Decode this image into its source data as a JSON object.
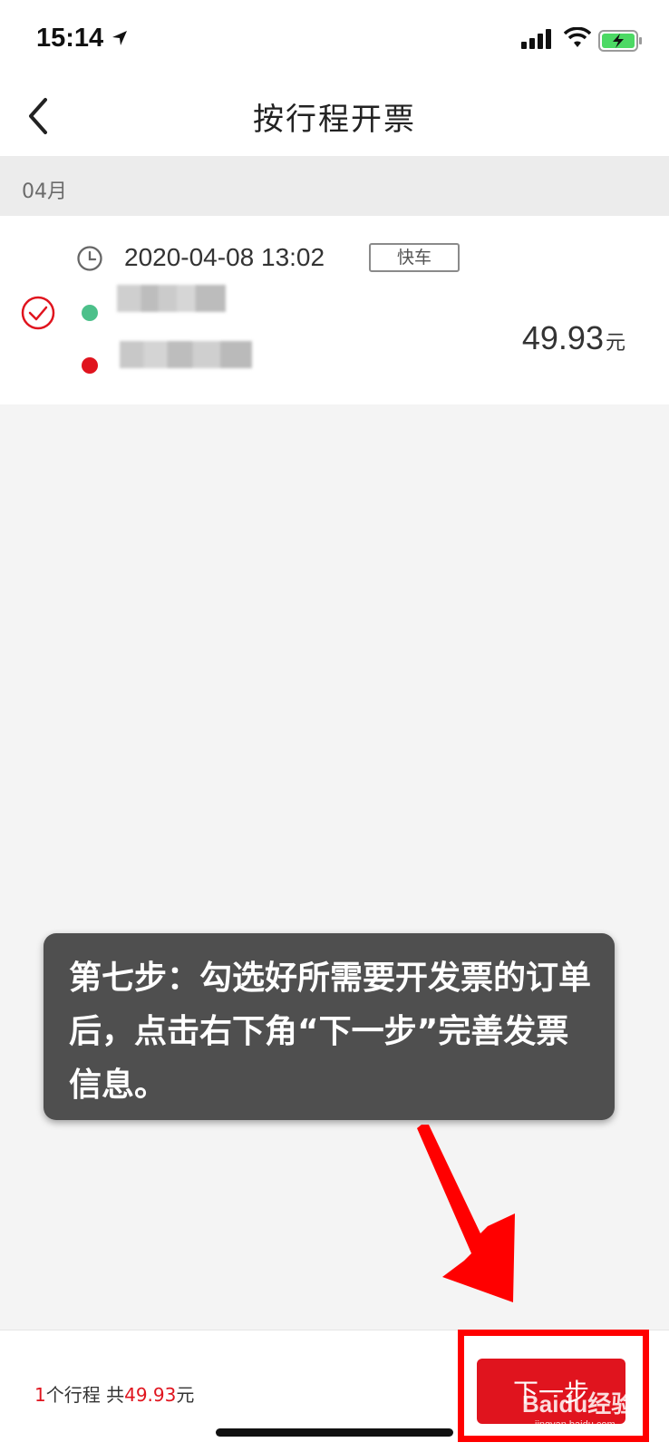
{
  "status_bar": {
    "time": "15:14"
  },
  "nav": {
    "title": "按行程开票"
  },
  "month": {
    "label": "04月"
  },
  "trip": {
    "datetime": "2020-04-08 13:02",
    "tag": "快车",
    "price": "49.93",
    "price_unit": "元",
    "selected": true
  },
  "tip": {
    "text": "第七步：勾选好所需要开发票的订单后，点击右下角“下一步”完善发票信息。"
  },
  "footer": {
    "count": "1",
    "count_suffix": "个行程 共",
    "total": "49.93",
    "total_unit": "元",
    "next_label": "下一步"
  },
  "watermark": {
    "logo": "Baidu经验",
    "url": "jingyan.baidu.com"
  },
  "colors": {
    "accent": "#e0141e",
    "start_dot": "#4cc08a",
    "end_dot": "#e0141e"
  }
}
